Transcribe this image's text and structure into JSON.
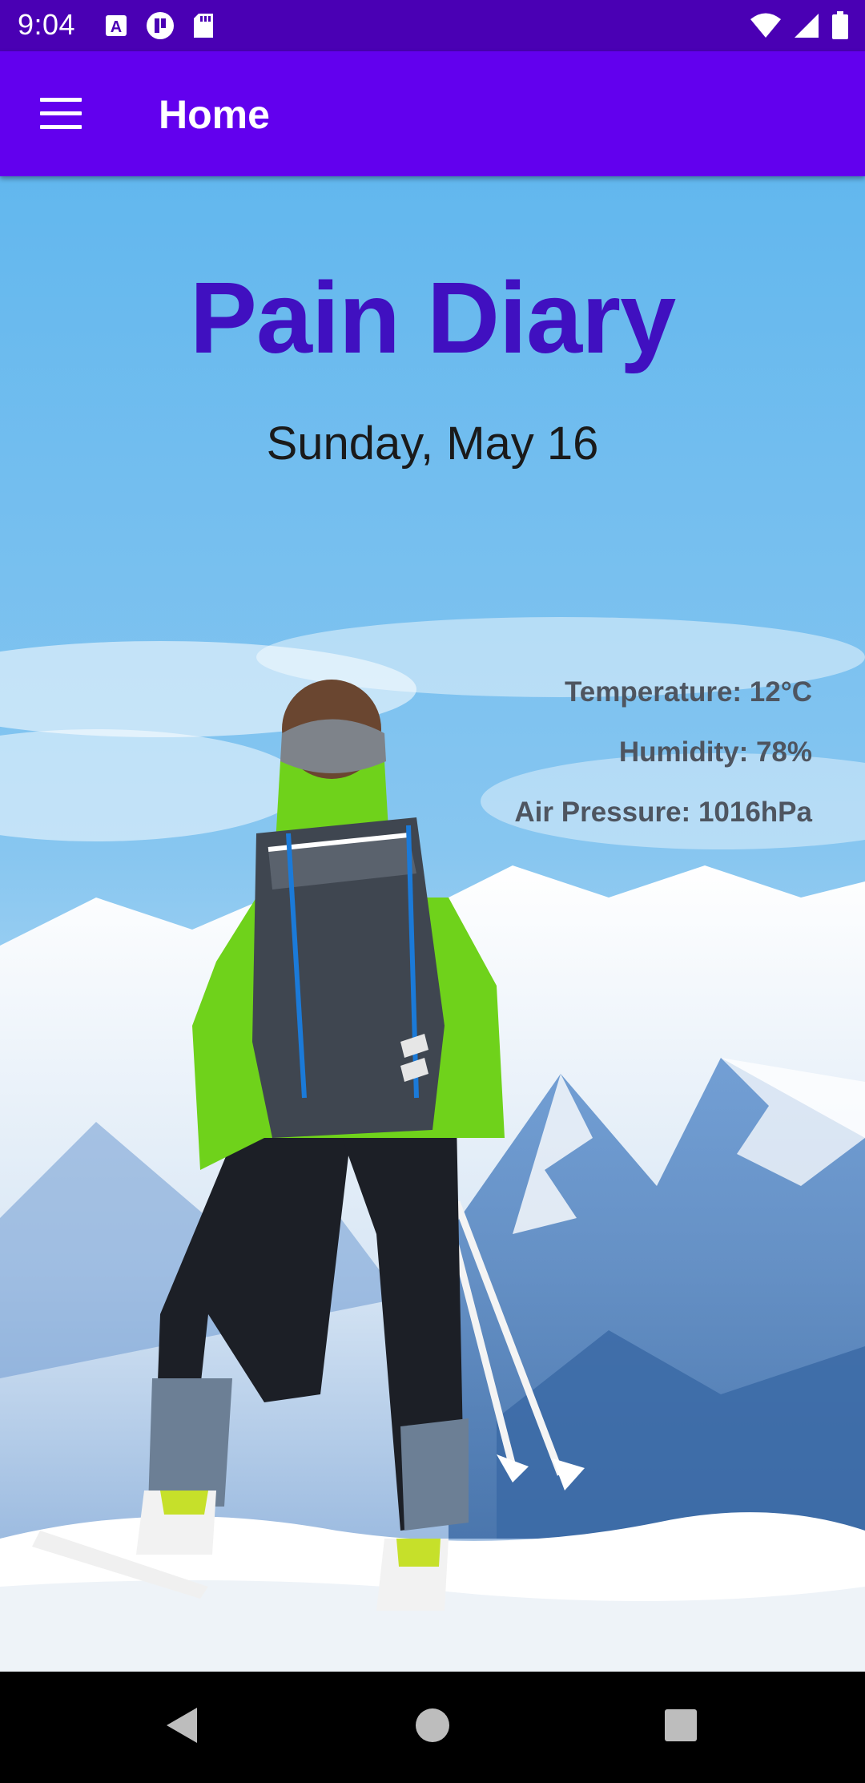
{
  "status_bar": {
    "time": "9:04",
    "left_icons": [
      "font-a-icon",
      "tv-app-icon",
      "sd-card-icon"
    ],
    "right_icons": [
      "wifi-icon",
      "cellular-signal-icon",
      "battery-icon"
    ]
  },
  "app_bar": {
    "menu_icon": "hamburger-menu-icon",
    "title": "Home"
  },
  "main": {
    "headline": "Pain Diary",
    "date": "Sunday, May 16",
    "weather": {
      "temperature": "Temperature: 12°C",
      "humidity": "Humidity: 78%",
      "air_pressure": "Air Pressure: 1016hPa"
    },
    "background_image": "skier-on-snowy-mountain"
  },
  "nav_bar": {
    "buttons": [
      "back-icon",
      "home-icon",
      "recents-icon"
    ]
  },
  "colors": {
    "status_bar": "#4a00b4",
    "app_bar": "#6200ee",
    "headline": "#4010c0",
    "weather_text": "#4e5560"
  }
}
